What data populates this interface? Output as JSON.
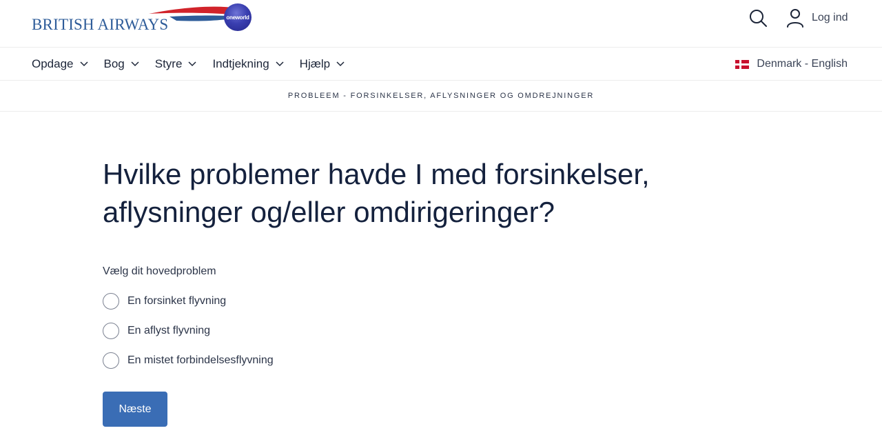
{
  "header": {
    "logo_text": "BRITISH AIRWAYS",
    "partner_badge": "oneworld",
    "login_label": "Log ind"
  },
  "nav": {
    "items": [
      {
        "label": "Opdage"
      },
      {
        "label": "Bog"
      },
      {
        "label": "Styre"
      },
      {
        "label": "Indtjekning"
      },
      {
        "label": "Hjælp"
      }
    ],
    "locale_label": "Denmark - English"
  },
  "breadcrumb": {
    "text": "PROBLEEM - FORSINKELSER, AFLYSNINGER OG OMDREJNINGER"
  },
  "main": {
    "headline_line1": "Hvilke problemer havde I med forsinkelser,",
    "headline_line2": "aflysninger og/eller omdirigeringer?",
    "question": "Vælg dit hovedproblem",
    "options": [
      {
        "label": "En forsinket flyvning"
      },
      {
        "label": "En aflyst flyvning"
      },
      {
        "label": "En mistet forbindelsesflyvning"
      }
    ],
    "next_label": "Næste"
  },
  "colors": {
    "brand_blue": "#2e5c99",
    "button_blue": "#3a6db5",
    "ribbon_red": "#d1232a",
    "text_dark": "#14213d"
  },
  "icons": {
    "search": "search-icon",
    "user": "user-icon",
    "chevron": "chevron-down-icon",
    "flag": "denmark-flag-icon"
  }
}
